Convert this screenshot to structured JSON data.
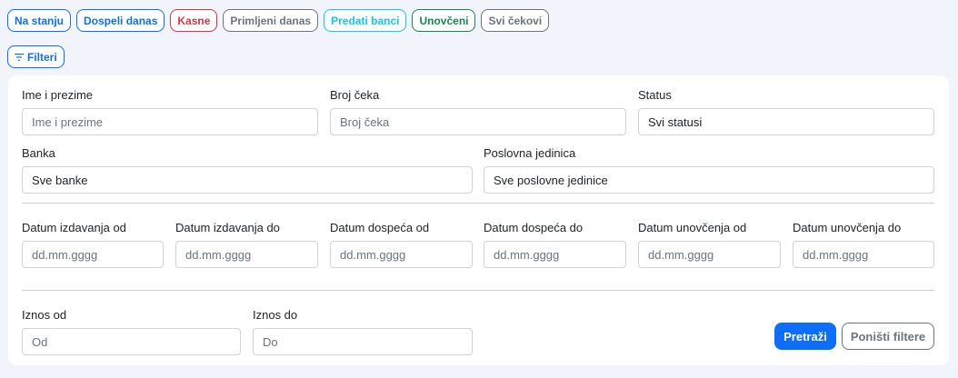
{
  "status_tabs": [
    {
      "label": "Na stanju",
      "color": "#0d6efd"
    },
    {
      "label": "Dospeli danas",
      "color": "#0d6efd"
    },
    {
      "label": "Kasne",
      "color": "#dc3545"
    },
    {
      "label": "Primljeni danas",
      "color": "#6c757d"
    },
    {
      "label": "Predati banci",
      "color": "#0dcaf0"
    },
    {
      "label": "Unovčeni",
      "color": "#198754"
    },
    {
      "label": "Svi čekovi",
      "color": "#6c757d"
    }
  ],
  "filter_button": {
    "label": "Filteri",
    "icon": "filter-icon"
  },
  "form": {
    "name": {
      "label": "Ime i prezime",
      "placeholder": "Ime i prezime",
      "value": ""
    },
    "check_number": {
      "label": "Broj čeka",
      "placeholder": "Broj čeka",
      "value": ""
    },
    "status": {
      "label": "Status",
      "value": "Svi statusi"
    },
    "bank": {
      "label": "Banka",
      "value": "Sve banke"
    },
    "business_unit": {
      "label": "Poslovna jedinica",
      "value": "Sve poslovne jedinice"
    },
    "issue_date_from": {
      "label": "Datum izdavanja od",
      "placeholder": "dd.mm.gggg"
    },
    "issue_date_to": {
      "label": "Datum izdavanja do",
      "placeholder": "dd.mm.gggg"
    },
    "due_date_from": {
      "label": "Datum dospeća od",
      "placeholder": "dd.mm.gggg"
    },
    "due_date_to": {
      "label": "Datum dospeća do",
      "placeholder": "dd.mm.gggg"
    },
    "cash_date_from": {
      "label": "Datum unovčenja od",
      "placeholder": "dd.mm.gggg"
    },
    "cash_date_to": {
      "label": "Datum unovčenja do",
      "placeholder": "dd.mm.gggg"
    },
    "amount_from": {
      "label": "Iznos od",
      "placeholder": "Od"
    },
    "amount_to": {
      "label": "Iznos do",
      "placeholder": "Do"
    }
  },
  "actions": {
    "search_label": "Pretraži",
    "reset_label": "Poništi filtere"
  },
  "colors": {
    "primary": "#0d6efd",
    "background": "#f1f4fb"
  }
}
